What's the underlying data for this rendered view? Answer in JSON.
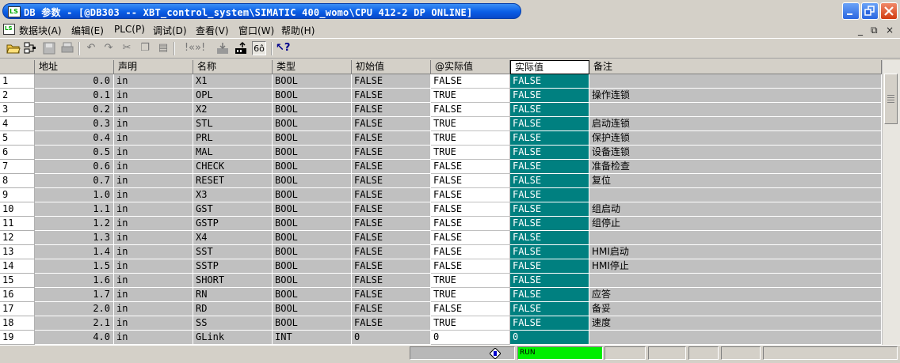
{
  "window": {
    "title": "DB 参数 - [@DB303 -- XBT_control_system\\SIMATIC 400_womo\\CPU 412-2 DP  ONLINE]",
    "app_icon_text": "LS"
  },
  "menu": {
    "items": [
      "数据块(A)",
      "编辑(E)",
      "PLC(P)",
      "调试(D)",
      "查看(V)",
      "窗口(W)",
      "帮助(H)"
    ],
    "mdi_controls": [
      "_",
      "⧉",
      "×"
    ]
  },
  "table": {
    "columns": [
      "地址",
      "声明",
      "名称",
      "类型",
      "初始值",
      "@实际值",
      "实际值",
      "备注"
    ],
    "active_column": "实际值",
    "rows": [
      {
        "n": "1",
        "addr": "0.0",
        "decl": "in",
        "name": "X1",
        "type": "BOOL",
        "init": "FALSE",
        "at_actual": "FALSE",
        "actual": "FALSE",
        "comment": ""
      },
      {
        "n": "2",
        "addr": "0.1",
        "decl": "in",
        "name": "OPL",
        "type": "BOOL",
        "init": "FALSE",
        "at_actual": "TRUE",
        "actual": "FALSE",
        "comment": "操作连锁"
      },
      {
        "n": "3",
        "addr": "0.2",
        "decl": "in",
        "name": "X2",
        "type": "BOOL",
        "init": "FALSE",
        "at_actual": "FALSE",
        "actual": "FALSE",
        "comment": ""
      },
      {
        "n": "4",
        "addr": "0.3",
        "decl": "in",
        "name": "STL",
        "type": "BOOL",
        "init": "FALSE",
        "at_actual": "TRUE",
        "actual": "FALSE",
        "comment": "启动连锁"
      },
      {
        "n": "5",
        "addr": "0.4",
        "decl": "in",
        "name": "PRL",
        "type": "BOOL",
        "init": "FALSE",
        "at_actual": "TRUE",
        "actual": "FALSE",
        "comment": "保护连锁"
      },
      {
        "n": "6",
        "addr": "0.5",
        "decl": "in",
        "name": "MAL",
        "type": "BOOL",
        "init": "FALSE",
        "at_actual": "TRUE",
        "actual": "FALSE",
        "comment": "设备连锁"
      },
      {
        "n": "7",
        "addr": "0.6",
        "decl": "in",
        "name": "CHECK",
        "type": "BOOL",
        "init": "FALSE",
        "at_actual": "FALSE",
        "actual": "FALSE",
        "comment": "准备检查"
      },
      {
        "n": "8",
        "addr": "0.7",
        "decl": "in",
        "name": "RESET",
        "type": "BOOL",
        "init": "FALSE",
        "at_actual": "FALSE",
        "actual": "FALSE",
        "comment": "复位"
      },
      {
        "n": "9",
        "addr": "1.0",
        "decl": "in",
        "name": "X3",
        "type": "BOOL",
        "init": "FALSE",
        "at_actual": "FALSE",
        "actual": "FALSE",
        "comment": ""
      },
      {
        "n": "10",
        "addr": "1.1",
        "decl": "in",
        "name": "GST",
        "type": "BOOL",
        "init": "FALSE",
        "at_actual": "FALSE",
        "actual": "FALSE",
        "comment": "组启动"
      },
      {
        "n": "11",
        "addr": "1.2",
        "decl": "in",
        "name": "GSTP",
        "type": "BOOL",
        "init": "FALSE",
        "at_actual": "FALSE",
        "actual": "FALSE",
        "comment": "组停止"
      },
      {
        "n": "12",
        "addr": "1.3",
        "decl": "in",
        "name": "X4",
        "type": "BOOL",
        "init": "FALSE",
        "at_actual": "FALSE",
        "actual": "FALSE",
        "comment": ""
      },
      {
        "n": "13",
        "addr": "1.4",
        "decl": "in",
        "name": "SST",
        "type": "BOOL",
        "init": "FALSE",
        "at_actual": "FALSE",
        "actual": "FALSE",
        "comment": "HMI启动"
      },
      {
        "n": "14",
        "addr": "1.5",
        "decl": "in",
        "name": "SSTP",
        "type": "BOOL",
        "init": "FALSE",
        "at_actual": "FALSE",
        "actual": "FALSE",
        "comment": "HMI停止"
      },
      {
        "n": "15",
        "addr": "1.6",
        "decl": "in",
        "name": "SHORT",
        "type": "BOOL",
        "init": "FALSE",
        "at_actual": "TRUE",
        "actual": "FALSE",
        "comment": ""
      },
      {
        "n": "16",
        "addr": "1.7",
        "decl": "in",
        "name": "RN",
        "type": "BOOL",
        "init": "FALSE",
        "at_actual": "TRUE",
        "actual": "FALSE",
        "comment": "应答"
      },
      {
        "n": "17",
        "addr": "2.0",
        "decl": "in",
        "name": "RD",
        "type": "BOOL",
        "init": "FALSE",
        "at_actual": "FALSE",
        "actual": "FALSE",
        "comment": "备妥"
      },
      {
        "n": "18",
        "addr": "2.1",
        "decl": "in",
        "name": "SS",
        "type": "BOOL",
        "init": "FALSE",
        "at_actual": "TRUE",
        "actual": "FALSE",
        "comment": "速度"
      },
      {
        "n": "19",
        "addr": "4.0",
        "decl": "in",
        "name": "GLink",
        "type": "INT",
        "init": "0",
        "at_actual": "0",
        "actual": "0",
        "comment": ""
      }
    ]
  },
  "status": {
    "run_label": "RUN"
  },
  "colors": {
    "actual_bg": "#008080",
    "grid_gray": "#c0c0c0",
    "run_green": "#00ee00",
    "title_blue": "#0a5ee6"
  }
}
